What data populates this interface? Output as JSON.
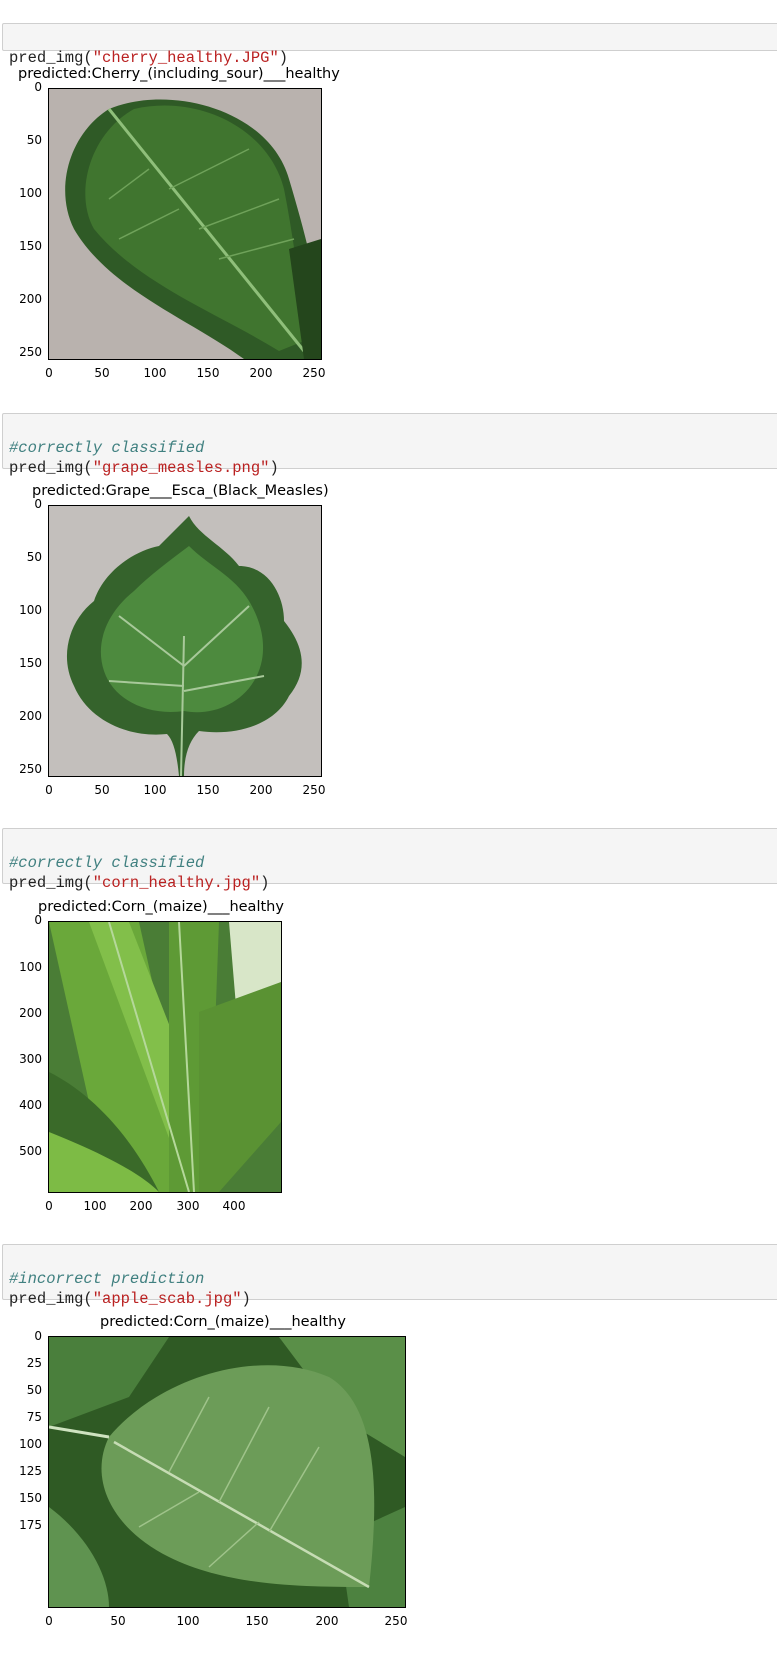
{
  "cells": [
    {
      "comment": "",
      "call": "pred_img(",
      "arg": "\"cherry_healthy.JPG\"",
      "close": ")"
    },
    {
      "comment": "#correctly classified",
      "call": "pred_img(",
      "arg": "\"grape_measles.png\"",
      "close": ")"
    },
    {
      "comment": "#correctly classified",
      "call": "pred_img(",
      "arg": "\"corn_healthy.jpg\"",
      "close": ")"
    },
    {
      "comment": "#incorrect prediction",
      "call": "pred_img(",
      "arg": "\"apple_scab.jpg\"",
      "close": ")"
    }
  ],
  "outputs": [
    {
      "title": "predicted:Cherry_(including_sour)___healthy",
      "yticks": [
        "0",
        "50",
        "100",
        "150",
        "200",
        "250"
      ],
      "xticks": [
        "0",
        "50",
        "100",
        "150",
        "200",
        "250"
      ],
      "image": "leaf-icon"
    },
    {
      "title": "predicted:Grape___Esca_(Black_Measles)",
      "yticks": [
        "0",
        "50",
        "100",
        "150",
        "200",
        "250"
      ],
      "xticks": [
        "0",
        "50",
        "100",
        "150",
        "200",
        "250"
      ],
      "image": "leaf-icon"
    },
    {
      "title": "predicted:Corn_(maize)___healthy",
      "yticks": [
        "0",
        "100",
        "200",
        "300",
        "400",
        "500"
      ],
      "xticks": [
        "0",
        "100",
        "200",
        "300",
        "400"
      ],
      "image": "leaf-icon"
    },
    {
      "title": "predicted:Corn_(maize)___healthy",
      "yticks": [
        "0",
        "25",
        "50",
        "75",
        "100",
        "125",
        "150",
        "175"
      ],
      "xticks": [
        "0",
        "50",
        "100",
        "150",
        "200",
        "250"
      ],
      "image": "leaf-icon"
    }
  ]
}
